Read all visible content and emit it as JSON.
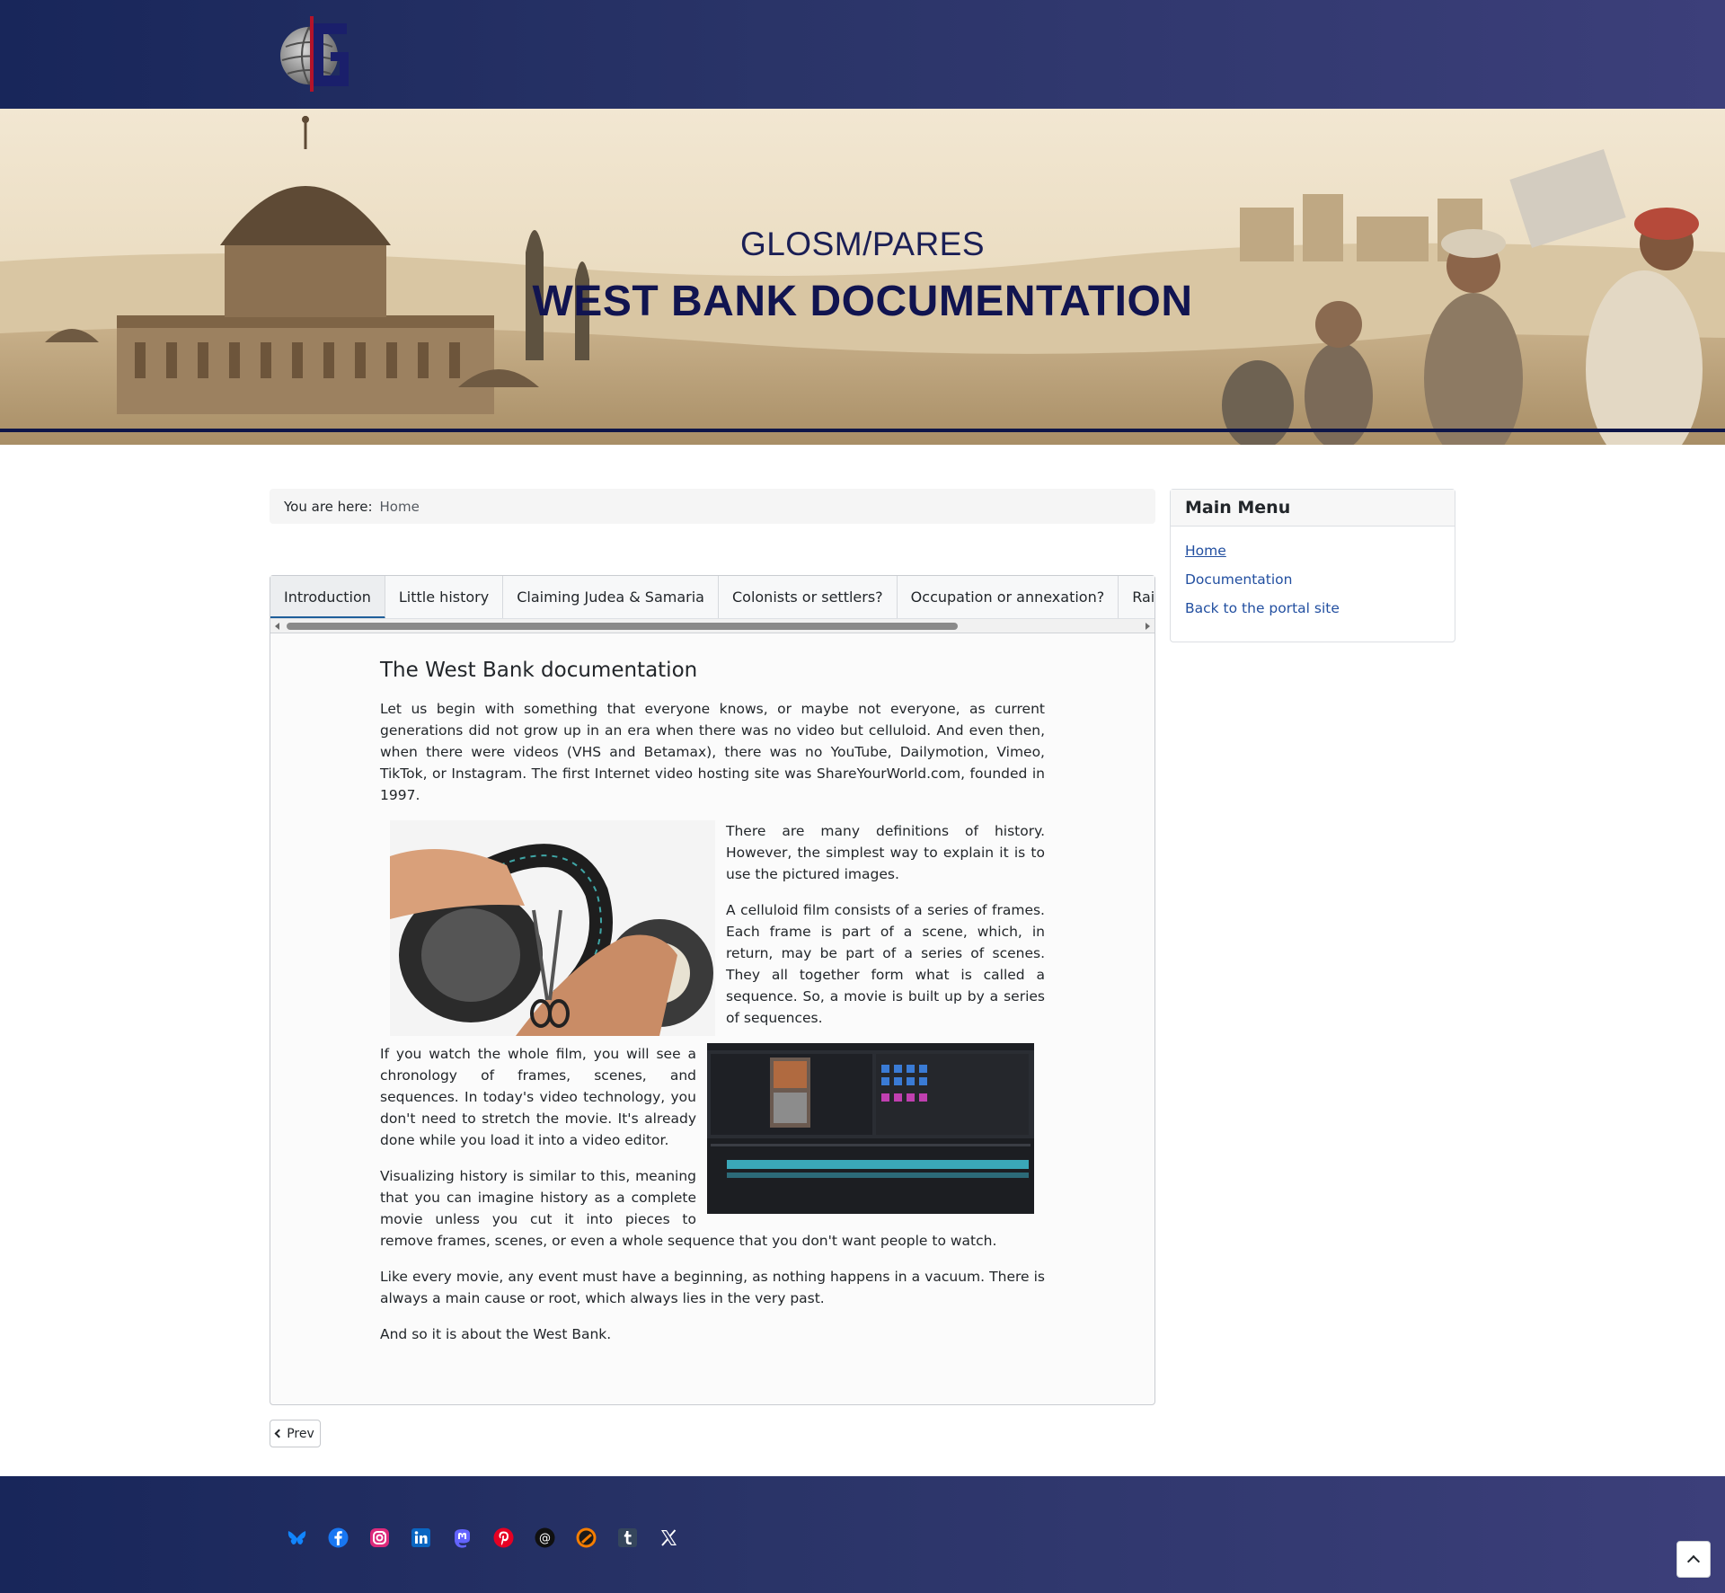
{
  "header": {
    "logo_icon": "globe-g-logo-icon"
  },
  "banner": {
    "subtitle": "GLOSM/PARES",
    "title": "WEST BANK DOCUMENTATION"
  },
  "breadcrumb": {
    "label": "You are here:",
    "home": "Home"
  },
  "tabs": [
    {
      "label": "Introduction",
      "active": true
    },
    {
      "label": "Little history"
    },
    {
      "label": "Claiming Judea & Samaria"
    },
    {
      "label": "Colonists or settlers?"
    },
    {
      "label": "Occupation or annexation?"
    },
    {
      "label": "Raids in the West Bank"
    }
  ],
  "article": {
    "title": "The West Bank documentation",
    "p1": "Let us begin with something that everyone knows, or maybe not everyone, as current generations did not grow up in an era when there was no video but celluloid. And even then, when there were videos (VHS and Betamax), there was no YouTube, Dailymotion, Vimeo, TikTok, or Instagram. The first Internet video hosting site was ShareYourWorld.com, founded in 1997.",
    "p2": "There are many definitions of history. However, the simplest way to explain it is to use the pictured images.",
    "p3": "A celluloid film consists of a series of frames. Each frame is part of a scene, which, in return, may be part of a series of scenes. They all together form what is called a sequence. So, a movie is built up by a series of sequences.",
    "p4": "If you watch the whole film, you will see a chronology of frames, scenes, and sequences. In today's video technology, you don't need to stretch the movie. It's already done while you load it into a video editor.",
    "p5": "Visualizing history is similar to this, meaning that you can imagine history as a complete movie unless you cut it into pieces to remove frames, scenes, or even a whole sequence that you don't want people to watch.",
    "p6": "Like every movie, any event must have a beginning, as nothing happens in a vacuum. There is always a main cause or root, which always lies in the very past.",
    "p7": "And so it is about the West Bank."
  },
  "pagination": {
    "prev": "Prev"
  },
  "main_menu": {
    "title": "Main Menu",
    "items": [
      "Home",
      "Documentation",
      "Back to the portal site"
    ]
  },
  "footer": {
    "social_icons": [
      "bluesky-icon",
      "facebook-icon",
      "instagram-icon",
      "linkedin-icon",
      "mastodon-icon",
      "pinterest-icon",
      "threads-icon",
      "blogger-icon",
      "tumblr-icon",
      "x-icon"
    ],
    "back_to_top_icon": "chevron-up-icon"
  },
  "colors": {
    "header_bg": "#1f2b60",
    "banner_title": "#111450",
    "link": "#224fa0",
    "tab_active_underline": "#1f5f9a"
  }
}
